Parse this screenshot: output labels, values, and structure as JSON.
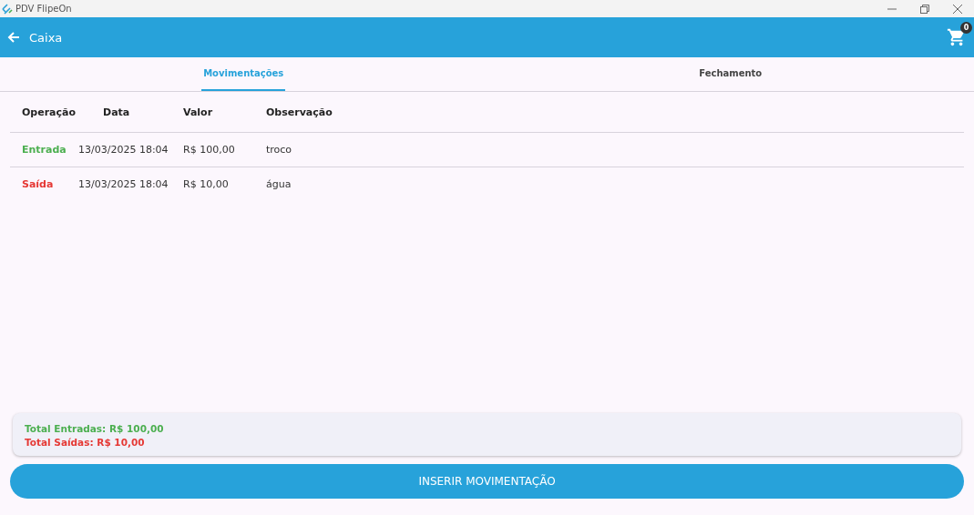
{
  "window": {
    "title": "PDV FlipeOn"
  },
  "app_bar": {
    "title": "Caixa",
    "cart_count": "0"
  },
  "tabs": [
    {
      "label": "Movimentações",
      "selected": true
    },
    {
      "label": "Fechamento",
      "selected": false
    }
  ],
  "table": {
    "columns": [
      "Operação",
      "Data",
      "Valor",
      "Observação"
    ],
    "rows": [
      {
        "kind": "entrada",
        "cells": [
          "Entrada",
          "13/03/2025 18:04",
          "R$ 100,00",
          "troco"
        ]
      },
      {
        "kind": "saida",
        "cells": [
          "Saída",
          "13/03/2025 18:04",
          "R$ 10,00",
          "água"
        ]
      }
    ]
  },
  "totals": [
    {
      "kind": "entrada",
      "text": "Total Entradas: R$ 100,00"
    },
    {
      "kind": "saida",
      "text": "Total Saídas: R$ 10,00"
    }
  ],
  "button": "INSERIR MOVIMENTAÇÃO"
}
